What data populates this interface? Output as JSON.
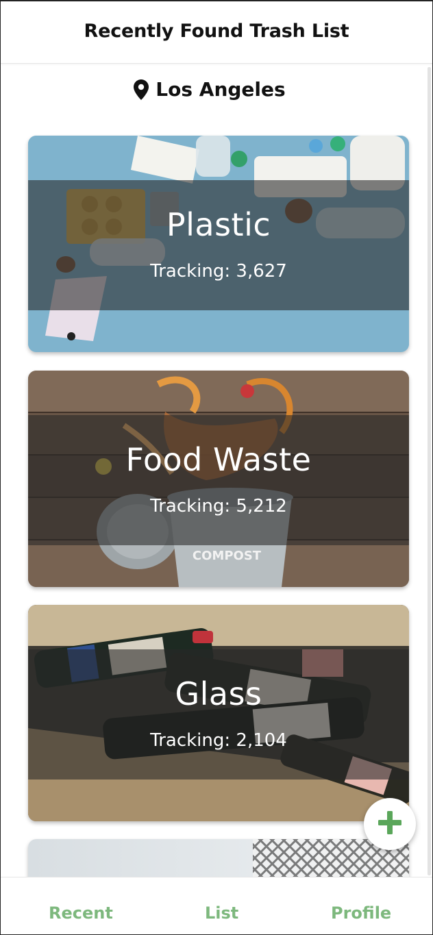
{
  "header": {
    "title": "Recently Found Trash List"
  },
  "location": {
    "label": "Los Angeles",
    "icon": "map-pin-icon"
  },
  "cards": [
    {
      "title": "Plastic",
      "tracking": "Tracking: 3,627"
    },
    {
      "title": "Food Waste",
      "tracking": "Tracking: 5,212"
    },
    {
      "title": "Glass",
      "tracking": "Tracking: 2,104"
    }
  ],
  "fab": {
    "icon": "plus-icon",
    "color": "#5aa65a"
  },
  "nav": {
    "recent": "Recent",
    "list": "List",
    "profile": "Profile",
    "color": "#7db87d"
  }
}
